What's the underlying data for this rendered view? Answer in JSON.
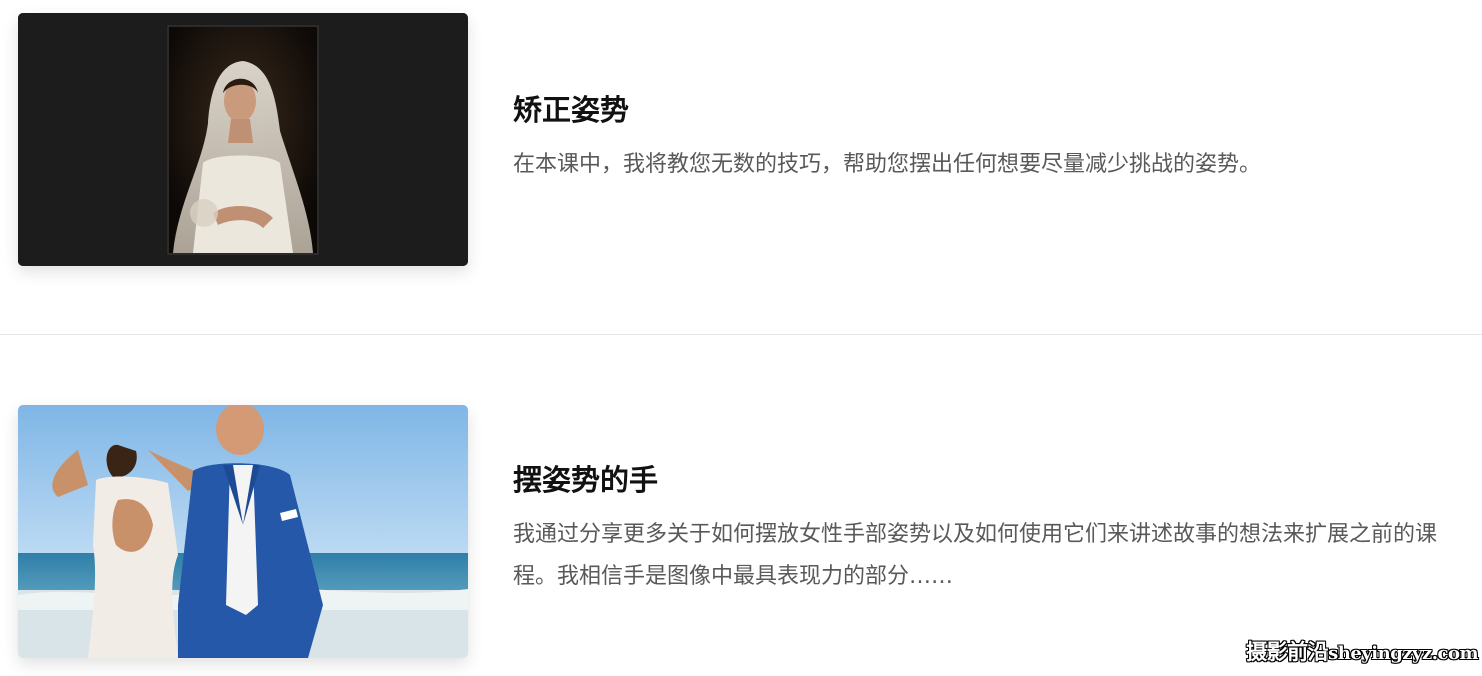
{
  "lessons": [
    {
      "title": "矫正姿势",
      "description": "在本课中，我将教您无数的技巧，帮助您摆出任何想要尽量减少挑战的姿势。"
    },
    {
      "title": "摆姿势的手",
      "description": "我通过分享更多关于如何摆放女性手部姿势以及如何使用它们来讲述故事的想法来扩展之前的课程。我相信手是图像中最具表现力的部分……"
    }
  ],
  "watermark": {
    "cn": "摄影前沿",
    "latin": "sheyingzyz.com"
  }
}
